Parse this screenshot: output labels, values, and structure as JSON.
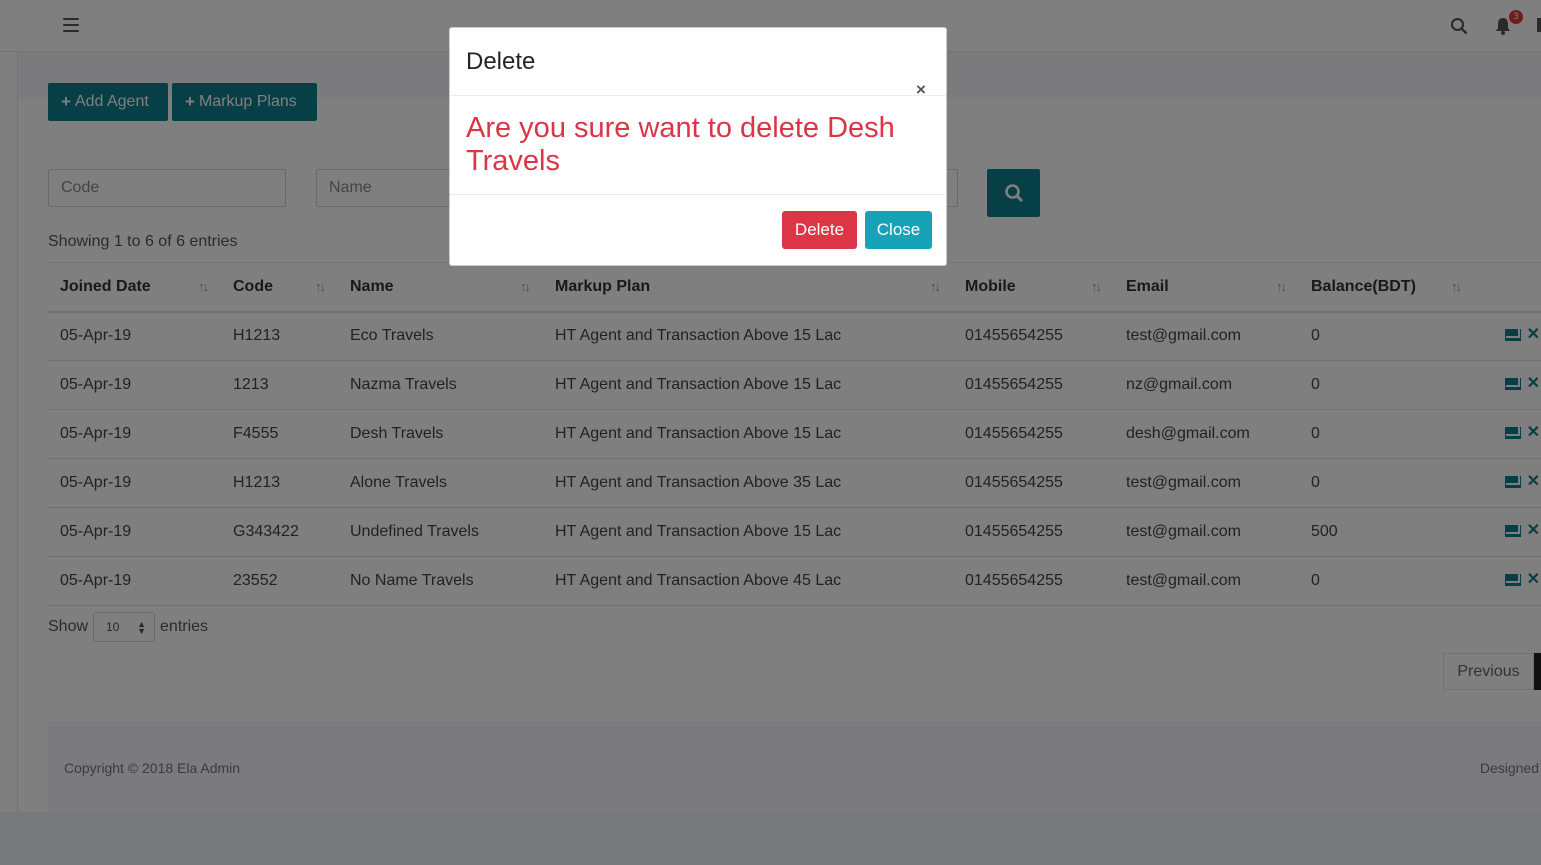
{
  "topbar": {
    "notification_count": "3"
  },
  "toolbar": {
    "add_agent_label": "Add Agent",
    "markup_plans_label": "Markup Plans"
  },
  "filters": {
    "code_placeholder": "Code",
    "name_placeholder": "Name"
  },
  "table": {
    "info": "Showing 1 to 6 of 6 entries",
    "headers": [
      "Joined Date",
      "Code",
      "Name",
      "Markup Plan",
      "Mobile",
      "Email",
      "Balance(BDT)"
    ],
    "rows": [
      {
        "joined": "05-Apr-19",
        "code": "H1213",
        "name": "Eco Travels",
        "plan": "HT Agent and Transaction Above 15 Lac",
        "mobile": "01455654255",
        "email": "test@gmail.com",
        "balance": "0"
      },
      {
        "joined": "05-Apr-19",
        "code": "1213",
        "name": "Nazma Travels",
        "plan": "HT Agent and Transaction Above 15 Lac",
        "mobile": "01455654255",
        "email": "nz@gmail.com",
        "balance": "0"
      },
      {
        "joined": "05-Apr-19",
        "code": "F4555",
        "name": "Desh Travels",
        "plan": "HT Agent and Transaction Above 15 Lac",
        "mobile": "01455654255",
        "email": "desh@gmail.com",
        "balance": "0"
      },
      {
        "joined": "05-Apr-19",
        "code": "H1213",
        "name": "Alone Travels",
        "plan": "HT Agent and Transaction Above 35 Lac",
        "mobile": "01455654255",
        "email": "test@gmail.com",
        "balance": "0"
      },
      {
        "joined": "05-Apr-19",
        "code": "G343422",
        "name": "Undefined Travels",
        "plan": "HT Agent and Transaction Above 15 Lac",
        "mobile": "01455654255",
        "email": "test@gmail.com",
        "balance": "500"
      },
      {
        "joined": "05-Apr-19",
        "code": "23552",
        "name": "No Name Travels",
        "plan": "HT Agent and Transaction Above 45 Lac",
        "mobile": "01455654255",
        "email": "test@gmail.com",
        "balance": "0"
      }
    ]
  },
  "length": {
    "show_label": "Show",
    "value": "10",
    "entries_label": "entries"
  },
  "pagination": {
    "previous_label": "Previous"
  },
  "footer": {
    "copyright": "Copyright © 2018 Ela Admin",
    "designed": "Designed"
  },
  "modal": {
    "title": "Delete",
    "close_x": "×",
    "message": "Are you sure want to delete Desh Travels",
    "delete_label": "Delete",
    "close_label": "Close"
  },
  "colors": {
    "accent": "#0f7e8f",
    "danger": "#dc3545",
    "info": "#17a2b8"
  }
}
